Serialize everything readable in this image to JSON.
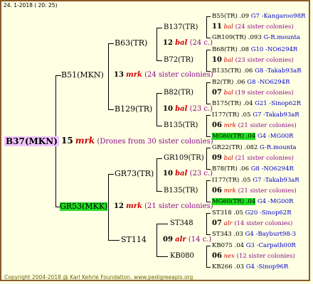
{
  "header": {
    "timestamp": "24. 1-2018 ( 20: 25)"
  },
  "footer": {
    "copyright": "Copyright 2004-2018 @ Karl Kehrle Foundation.",
    "site": "www.pedigreeapis.org"
  },
  "root": {
    "name": "B37(MKN)",
    "year": "15",
    "mark": "mrk",
    "note": "(Drones from 30 sister colonies)"
  },
  "l1": [
    {
      "name": "B51(MKN)",
      "year": "13",
      "mark": "mrk",
      "note": "(24 sister colonies)"
    },
    {
      "name": "GR53(MKK)",
      "year": "12",
      "mark": "mrk",
      "note": "(21 sister colonies)"
    }
  ],
  "l2": [
    {
      "name": "B63(TR)",
      "year": "12",
      "mark": "bal",
      "note": "(24 c.)"
    },
    {
      "name": "B129(TR)",
      "year": "10",
      "mark": "bal",
      "note": "(23 c.)"
    },
    {
      "name": "GR73(TR)",
      "year": "10",
      "mark": "bal",
      "note": "(23 c.)"
    },
    {
      "name": "ST114",
      "year": "09",
      "mark": "alr",
      "note": "(14 c.)"
    }
  ],
  "l3": [
    {
      "name": "B137(TR)"
    },
    {
      "name": "B72(TR)"
    },
    {
      "name": "B82(TR)"
    },
    {
      "name": "B135(TR)"
    },
    {
      "name": "GR109(TR)"
    },
    {
      "name": "B135(TR)"
    },
    {
      "name": "ST348"
    },
    {
      "name": "KB080"
    }
  ],
  "l4": [
    {
      "top": "B55(TR) .09",
      "top_r": "G7 -Kangaroo98R",
      "year": "11",
      "mark": "bal",
      "note": "(24 sister colonies)",
      "bot": "GR109(TR) .093",
      "bot_r": "G-R.mounta"
    },
    {
      "top": "B68(TR) .08",
      "top_r": "G10 -NO6294R",
      "year": "10",
      "mark": "bal",
      "note": "(23 sister colonies)",
      "bot": "B135(TR) .06",
      "bot_r": "G8 -Takab93aR"
    },
    {
      "top": "B2(TR) .06",
      "top_r": "G8 -NO6294R",
      "year": "07",
      "mark": "bal",
      "note": "(19 sister colonies)",
      "bot": "B175(TR) .04",
      "bot_r": "G21 -Sinop62R"
    },
    {
      "top": "I177(TR) .05",
      "top_r": "G7 -Takab93aR",
      "year": "06",
      "mark": "mrk",
      "note": "(21 sister colonies)",
      "bot": "MG60(TR) .04",
      "bot_r": "G4 -MG00R"
    },
    {
      "top": "GR22(TR) .082",
      "top_r": "G-R.mounta",
      "year": "09",
      "mark": "bal",
      "note": "(21 sister colonies)",
      "bot": "B78(TR) .06",
      "bot_r": "G8 -NO6294R"
    },
    {
      "top": "I177(TR) .05",
      "top_r": "G7 -Takab93aR",
      "year": "06",
      "mark": "mrk",
      "note": "(21 sister colonies)",
      "bot": "MG60(TR) .04",
      "bot_r": "G4 -MG00R"
    },
    {
      "top": "ST318 .05",
      "top_r": "G20 -Sinop62R",
      "year": "07",
      "mark": "alr",
      "note": "(14 sister colonies)",
      "bot": "ST343 .03",
      "bot_r": "G4 -Bayburt98-3"
    },
    {
      "top": "KB075 .04",
      "top_r": "G3 -Carpath00R",
      "year": "06",
      "mark": "nex",
      "note": "(12 sister colonies)",
      "bot": "KB266 .03",
      "bot_r": "G4 -Sinop96R"
    }
  ]
}
